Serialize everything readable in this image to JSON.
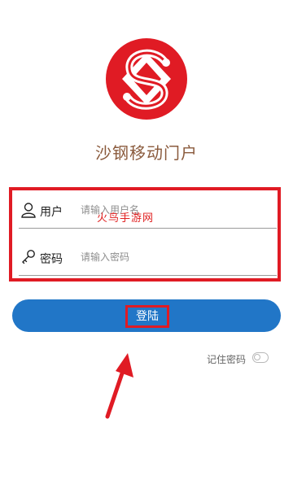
{
  "app": {
    "title": "沙钢移动门户",
    "logo_name": "shagang-logo",
    "brand_color": "#e01b24"
  },
  "form": {
    "username": {
      "label": "用户",
      "placeholder": "请输入用户名",
      "value": "",
      "icon": "user-icon"
    },
    "password": {
      "label": "密码",
      "placeholder": "请输入密码",
      "value": "",
      "icon": "key-icon"
    }
  },
  "watermark": "火鸟手游网",
  "login": {
    "label": "登陆",
    "color": "#2176c7"
  },
  "remember": {
    "label": "记住密码",
    "checked": false
  },
  "annotation": {
    "highlight_color": "#e01b24",
    "arrow": "up-arrow-icon"
  }
}
